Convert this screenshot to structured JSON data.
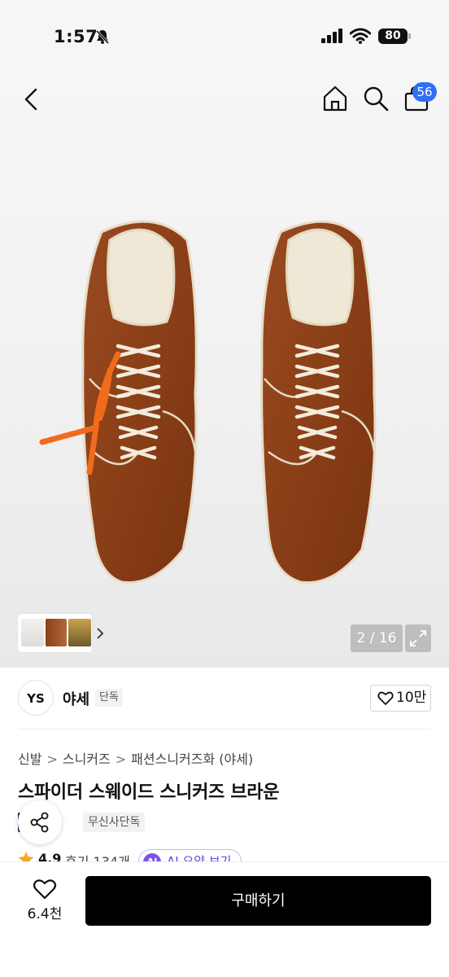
{
  "status_bar": {
    "time": "1:57",
    "battery": "80"
  },
  "nav": {
    "cart_badge": "56"
  },
  "gallery": {
    "counter": "2 / 16"
  },
  "brand": {
    "logo_text": "YS",
    "name": "야세",
    "badge": "단독",
    "likes": "10만"
  },
  "breadcrumb": [
    "신발",
    "스니커즈",
    "패션스니커즈화 (야세)"
  ],
  "product": {
    "title": "스파이더 스웨이드 스니커즈 브라운"
  },
  "tags": {
    "dark": "이",
    "light": "무신사단독"
  },
  "rating": {
    "value": "4.9",
    "reviews": "후기 134개",
    "ai_label": "AI 요약 보기",
    "ai_icon": "AI"
  },
  "bottom": {
    "wish_count": "6.4천",
    "buy_label": "구매하기"
  },
  "colors": {
    "accent": "#2f6ff5",
    "suede": "#8b3f16",
    "lace": "#f26a1b",
    "ai": "#7b55e6"
  }
}
